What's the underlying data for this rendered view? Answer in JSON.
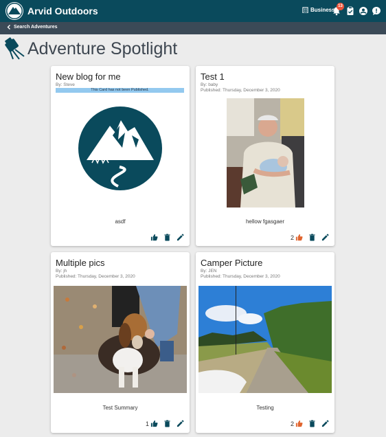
{
  "app": {
    "title": "Arvid Outdoors"
  },
  "header": {
    "business_label": "Business",
    "notification_count": "13"
  },
  "subbar": {
    "back_label": "Search Adventures"
  },
  "page": {
    "title": "Adventure Spotlight"
  },
  "cards": [
    {
      "title": "New blog for me",
      "by": "By: Steve",
      "published": "",
      "notice": "This Card has not been Published.",
      "summary": "asdf",
      "likes": "",
      "liked": false
    },
    {
      "title": "Test 1",
      "by": "By: baby",
      "published": "Published: Thursday, December 3, 2020",
      "notice": "",
      "summary": "hellow fgasgaer",
      "likes": "2",
      "liked": true
    },
    {
      "title": "Multiple pics",
      "by": "By: jh",
      "published": "Published: Thursday, December 3, 2020",
      "notice": "",
      "summary": "Test Summary",
      "likes": "1",
      "liked": false
    },
    {
      "title": "Camper Picture",
      "by": "By: JEN",
      "published": "Published: Thursday, December 3, 2020",
      "notice": "",
      "summary": "Testing",
      "likes": "2",
      "liked": true
    }
  ],
  "colors": {
    "brand": "#0a4a5c",
    "subbar": "#3b4a57",
    "like_active": "#e0642e",
    "badge": "#e8533a",
    "notice": "#93c9ef"
  }
}
